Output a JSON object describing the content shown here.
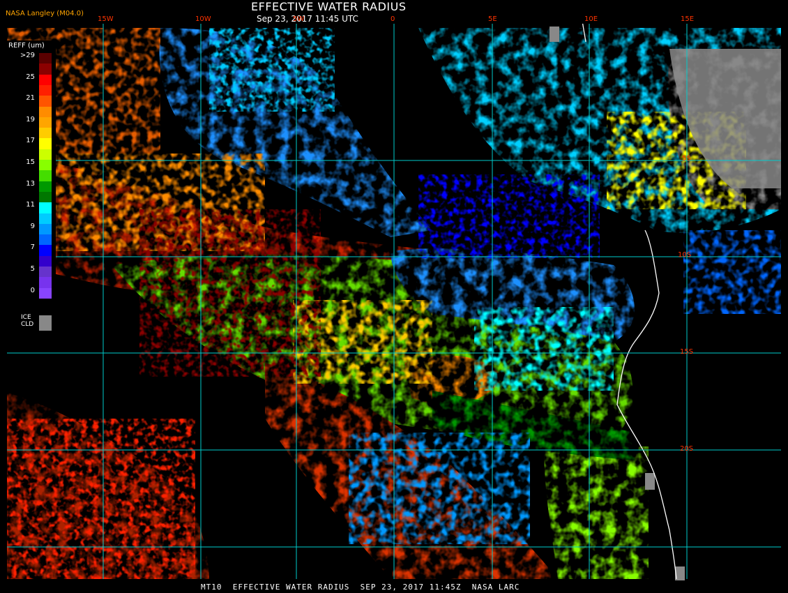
{
  "title": "EFFECTIVE WATER RADIUS",
  "subtitle": "Sep 23, 2017 11:45 UTC",
  "credit": "NASA Langley (M04.0)",
  "footer": "MT10  EFFECTIVE WATER RADIUS  SEP 23, 2017 11:45Z  NASA LARC",
  "legend": {
    "title": "REFF (um)",
    "bins": [
      {
        "label": ">29",
        "color": "#5a0000"
      },
      {
        "label": "",
        "color": "#8b0000"
      },
      {
        "label": "25",
        "color": "#ff0000"
      },
      {
        "label": "",
        "color": "#ff2000"
      },
      {
        "label": "21",
        "color": "#ff5500"
      },
      {
        "label": "",
        "color": "#ff8c00"
      },
      {
        "label": "19",
        "color": "#ffa500"
      },
      {
        "label": "",
        "color": "#ffcc00"
      },
      {
        "label": "17",
        "color": "#ffff00"
      },
      {
        "label": "",
        "color": "#ccff00"
      },
      {
        "label": "15",
        "color": "#88ff00"
      },
      {
        "label": "",
        "color": "#44dd00"
      },
      {
        "label": "13",
        "color": "#009900"
      },
      {
        "label": "",
        "color": "#007700"
      },
      {
        "label": "11",
        "color": "#00ffff"
      },
      {
        "label": "",
        "color": "#00ccff"
      },
      {
        "label": "9",
        "color": "#0099ff"
      },
      {
        "label": "",
        "color": "#0066ff"
      },
      {
        "label": "7",
        "color": "#0000ff"
      },
      {
        "label": "",
        "color": "#3300cc"
      },
      {
        "label": "5",
        "color": "#6633cc"
      },
      {
        "label": "",
        "color": "#7733ee"
      },
      {
        "label": "0",
        "color": "#8844ff"
      }
    ],
    "ice_label_1": "ICE",
    "ice_label_2": "CLD",
    "ice_color": "#888888"
  },
  "longitudes": [
    "15W",
    "10W",
    "5W",
    "0",
    "5E",
    "10E",
    "15E"
  ],
  "latitudes": [
    "5S",
    "10S",
    "15S",
    "20S"
  ],
  "grid_color": "#00cccc",
  "label_color": "#ff3300"
}
